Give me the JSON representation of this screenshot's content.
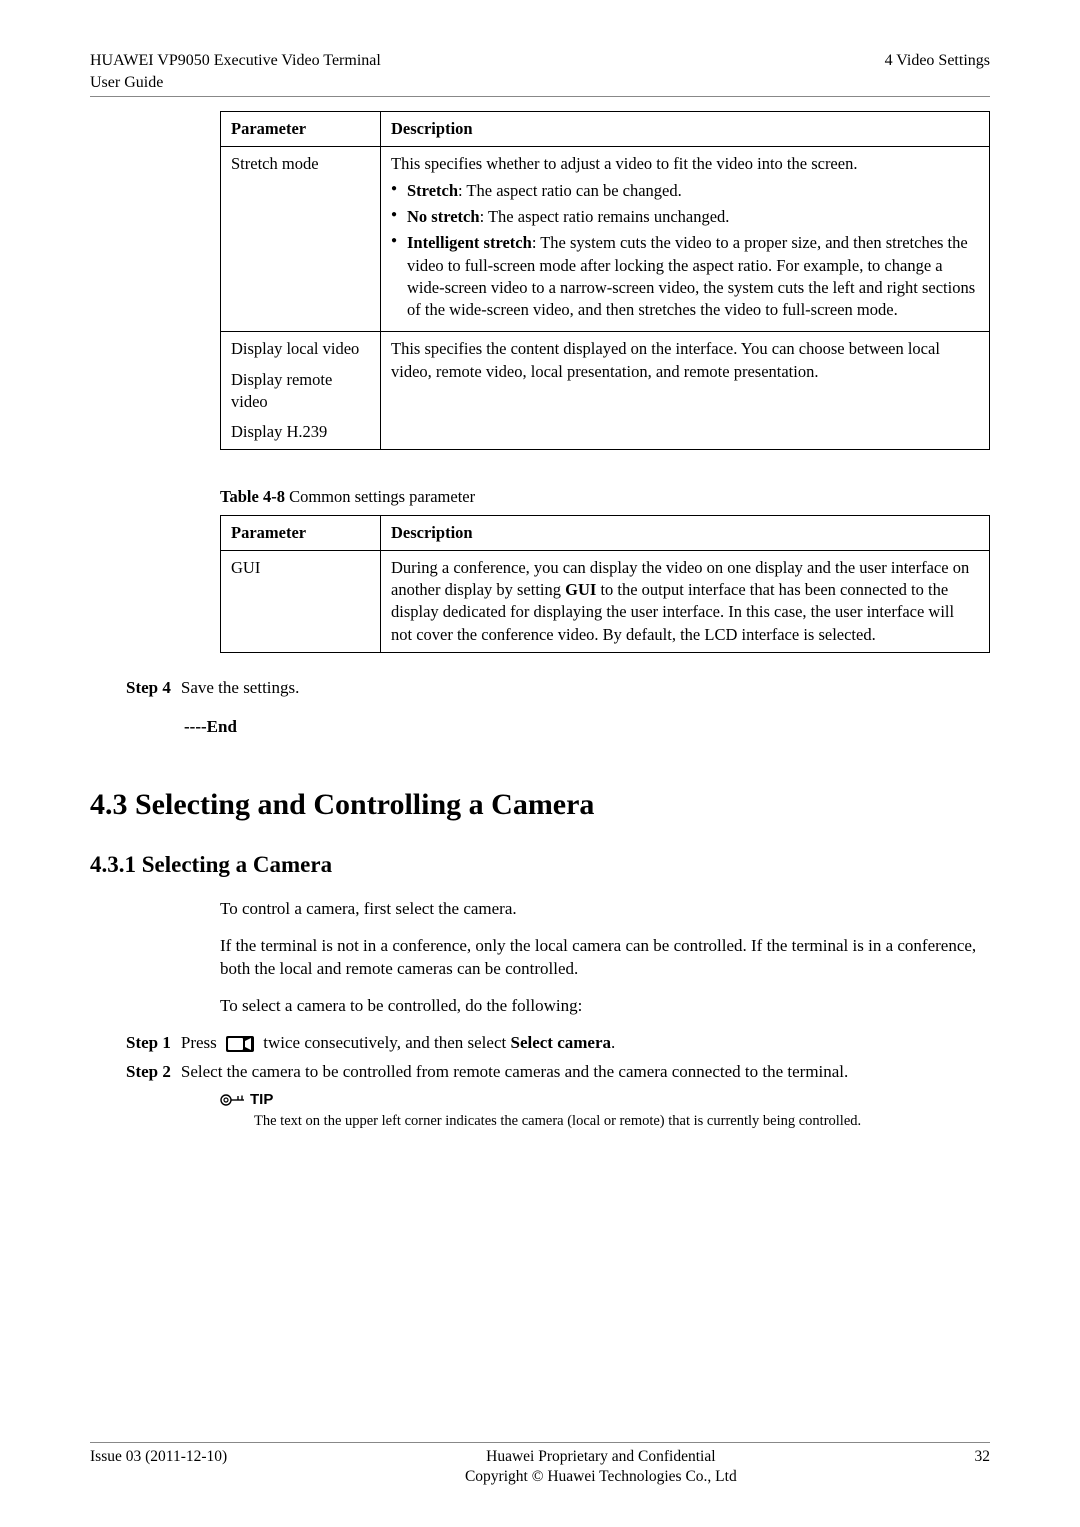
{
  "header": {
    "left_line1": "HUAWEI VP9050 Executive Video Terminal",
    "left_line2": "User Guide",
    "right": "4 Video Settings"
  },
  "table1": {
    "head_param": "Parameter",
    "head_desc": "Description",
    "rows": [
      {
        "param": "Stretch mode",
        "desc_para": "This specifies whether to adjust a video to fit the video into the screen.",
        "bullets": [
          {
            "bold": "Stretch",
            "rest": ": The aspect ratio can be changed."
          },
          {
            "bold": "No stretch",
            "rest": ": The aspect ratio remains unchanged."
          },
          {
            "bold": "Intelligent stretch",
            "rest": ": The system cuts the video to a proper size, and then stretches the video to full-screen mode after locking the aspect ratio. For example, to change a wide-screen video to a narrow-screen video, the system cuts the left and right sections of the wide-screen video, and then stretches the video to full-screen mode."
          }
        ]
      },
      {
        "param_lines": [
          "Display local video",
          "Display remote video",
          "Display H.239"
        ],
        "desc_plain": "This specifies the content displayed on the interface. You can choose between local video, remote video, local presentation, and remote presentation."
      }
    ]
  },
  "table2_caption_bold": "Table 4-8",
  "table2_caption_rest": " Common settings parameter",
  "table2": {
    "head_param": "Parameter",
    "head_desc": "Description",
    "row": {
      "param": "GUI",
      "desc_pre": "During a conference, you can display the video on one display and the user interface on another display by setting ",
      "desc_bold": "GUI",
      "desc_post": " to the output interface that has been connected to the display dedicated for displaying the user interface. In this case, the user interface will not cover the conference video. By default, the LCD interface is selected."
    }
  },
  "step4": {
    "label": "Step 4",
    "text": "Save the settings."
  },
  "end": "----End",
  "section_title": "4.3 Selecting and Controlling a Camera",
  "subsection_title": "4.3.1 Selecting a Camera",
  "p1": "To control a camera, first select the camera.",
  "p2": "If the terminal is not in a conference, only the local camera can be controlled. If the terminal is in a conference, both the local and remote cameras can be controlled.",
  "p3": "To select a camera to be controlled, do the following:",
  "step1": {
    "label": "Step 1",
    "pre": "Press ",
    "mid": " twice consecutively, and then select ",
    "bold": "Select camera",
    "post": "."
  },
  "step2": {
    "label": "Step 2",
    "text": "Select the camera to be controlled from remote cameras and the camera connected to the terminal."
  },
  "tip": {
    "label": "TIP",
    "text": "The text on the upper left corner indicates the camera (local or remote) that is currently being controlled."
  },
  "footer": {
    "left": "Issue 03 (2011-12-10)",
    "center1": "Huawei Proprietary and Confidential",
    "center2": "Copyright © Huawei Technologies Co., Ltd",
    "right": "32"
  }
}
